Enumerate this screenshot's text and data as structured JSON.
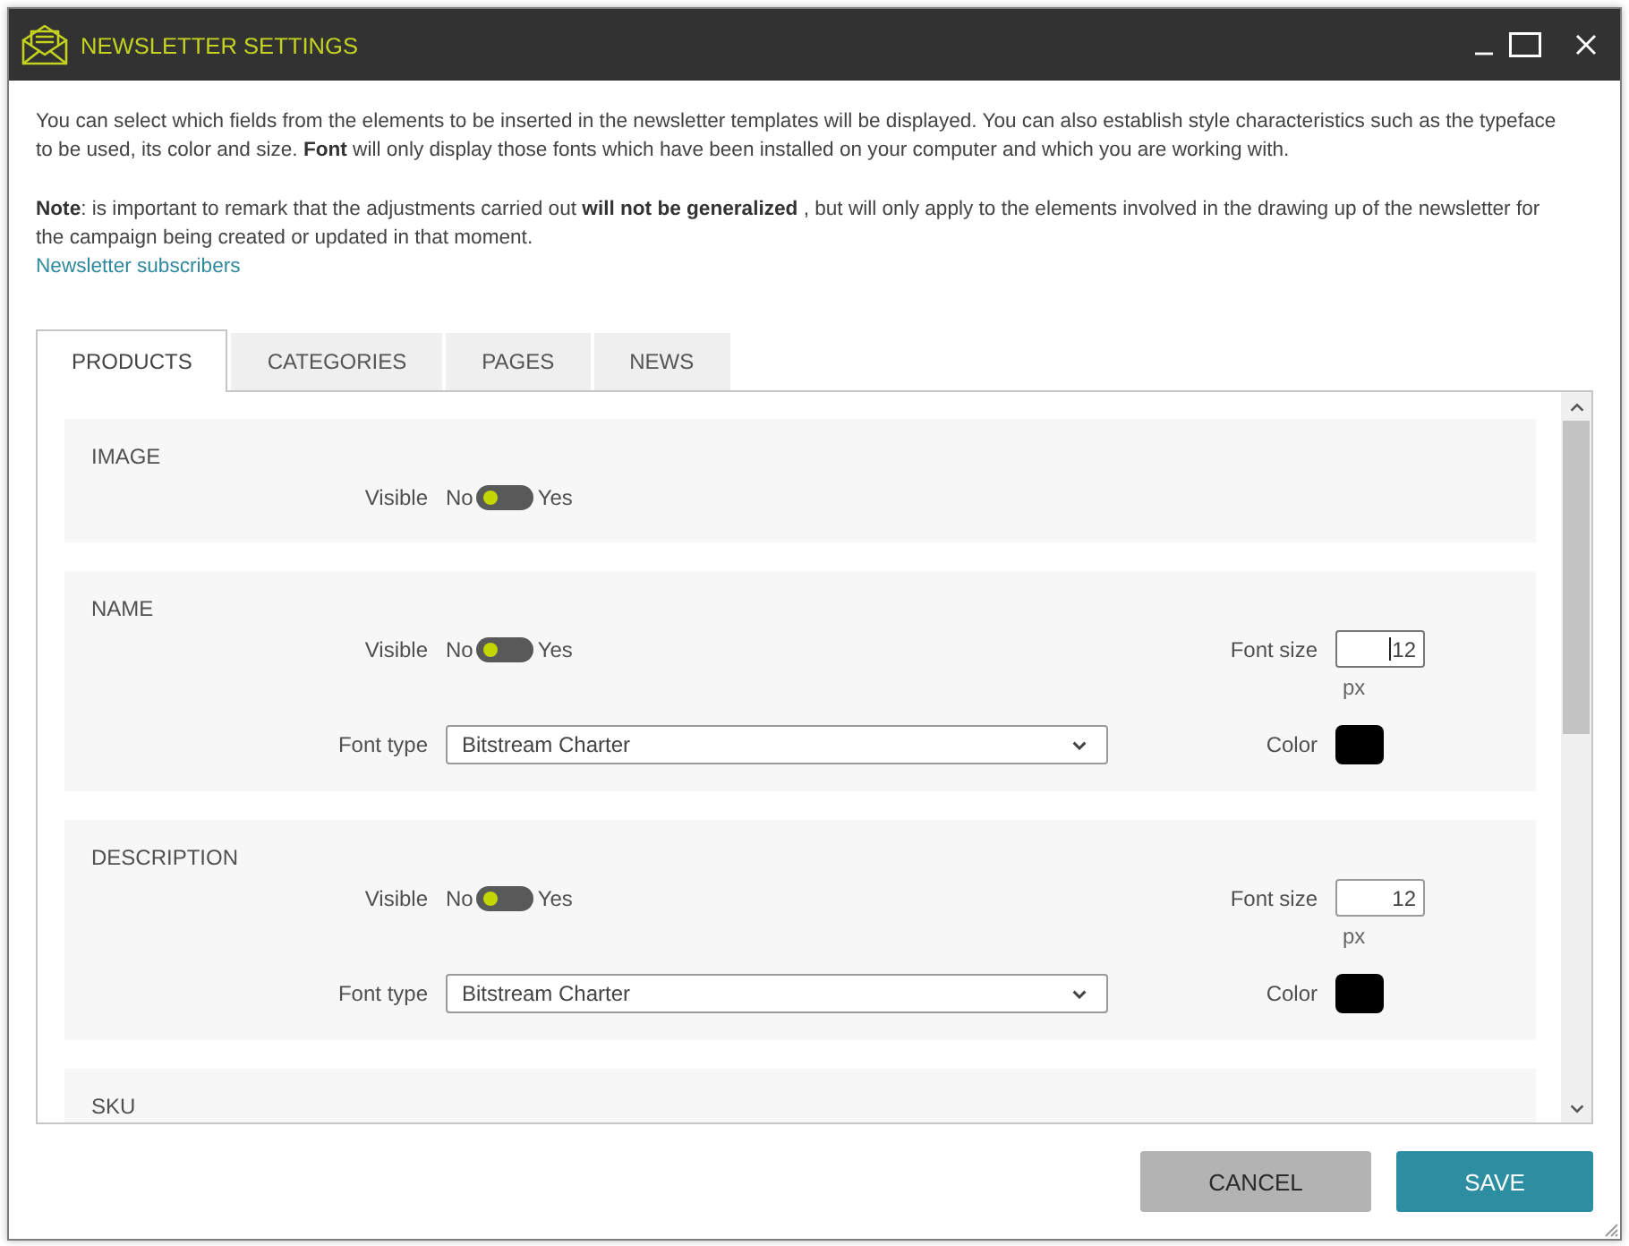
{
  "window": {
    "title": "NEWSLETTER SETTINGS"
  },
  "intro": "You can select which fields from the elements to be inserted in the newsletter templates will be displayed. You can also establish style characteristics such as the typeface to be used, its color and size. **Font** will only display those fonts which have been installed on your computer and which you are working with.",
  "note": "**Note**: is important to remark that the adjustments carried out **will not be generalized** , but will only apply to the elements involved in the drawing up of the newsletter for the campaign being created or updated in that moment.",
  "link": "Newsletter subscribers",
  "tabs": [
    {
      "label": "PRODUCTS",
      "selected": true
    },
    {
      "label": "CATEGORIES",
      "selected": false
    },
    {
      "label": "PAGES",
      "selected": false
    },
    {
      "label": "NEWS",
      "selected": false
    }
  ],
  "sections": [
    {
      "kind": "visibility",
      "title": "IMAGE",
      "visible": {
        "label": "Visible",
        "off_label": "No",
        "on_label": "Yes",
        "on": false
      }
    },
    {
      "kind": "styled",
      "title": "NAME",
      "visible": {
        "label": "Visible",
        "off_label": "No",
        "on_label": "Yes",
        "on": false
      },
      "font_size": {
        "label": "Font size",
        "value": "12",
        "unit": "px",
        "focused": true
      },
      "font_type": {
        "label": "Font type",
        "value": "Bitstream Charter"
      },
      "color": {
        "label": "Color",
        "color": "#000000"
      }
    },
    {
      "kind": "styled",
      "title": "DESCRIPTION",
      "visible": {
        "label": "Visible",
        "off_label": "No",
        "on_label": "Yes",
        "on": false
      },
      "font_size": {
        "label": "Font size",
        "value": "12",
        "unit": "px",
        "focused": false
      },
      "font_type": {
        "label": "Font type",
        "value": "Bitstream Charter"
      },
      "color": {
        "label": "Color",
        "color": "#000000"
      }
    },
    {
      "kind": "heading",
      "title": "SKU"
    }
  ],
  "buttons": [
    {
      "label": "CANCEL",
      "kind": "secondary"
    },
    {
      "label": "SAVE",
      "kind": "primary"
    }
  ]
}
